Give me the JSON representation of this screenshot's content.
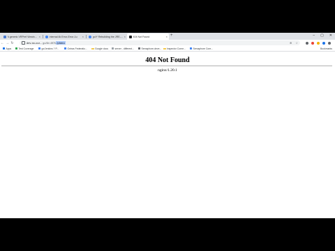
{
  "tabs": [
    {
      "title": "A generic VRPerf Viewing S",
      "active": false,
      "favicon_color": "#4a7bd0"
    },
    {
      "title": "Internal 4k Error-Error-1u",
      "active": false,
      "favicon_color": "#4285f4"
    },
    {
      "title": "go/Y Rebuilding the JRE-Sc",
      "active": false,
      "favicon_color": "#4285f4"
    },
    {
      "title": "404 Not Found",
      "active": true,
      "favicon_color": "#202124"
    }
  ],
  "new_tab_symbol": "+",
  "window_controls": {
    "minimize": "–",
    "maximize": "▢",
    "close": "✕"
  },
  "toolbar": {
    "back": "←",
    "forward": "→",
    "reload": "↻"
  },
  "address_bar": {
    "url_host": "dev-nc-cur...",
    "url_path": "go/6r=8f7b",
    "url_selected": "/phero",
    "extension_colors": [
      "#5f6368",
      "#ea4335",
      "#f4b400",
      "#1a73e8",
      "#5f6368"
    ],
    "actions": {
      "zoom": "⊕",
      "star": "☆"
    }
  },
  "bookmarks": [
    {
      "label": "Apps",
      "kind": "icon",
      "color": "#1a73e8"
    },
    {
      "label": "Test Coverage",
      "kind": "icon",
      "color": "#34a853"
    },
    {
      "label": "go/Jenkins ? P...",
      "kind": "icon",
      "color": "#4285f4"
    },
    {
      "label": "Ontras Federatio...",
      "kind": "icon",
      "color": "#4285f4"
    },
    {
      "label": "Google docs",
      "kind": "folder",
      "color": "#f2c94c"
    },
    {
      "label": "server - different...",
      "kind": "icon",
      "color": "#9aa0a6"
    },
    {
      "label": "Semaphore-deve...",
      "kind": "icon",
      "color": "#5f6368"
    },
    {
      "label": "Inspector Corne...",
      "kind": "folder",
      "color": "#f2c94c"
    },
    {
      "label": "Semaphore Core...",
      "kind": "icon",
      "color": "#4285f4"
    }
  ],
  "other_bookmarks": "Bookmarks",
  "page": {
    "heading": "404 Not Found",
    "server": "nginx/1.20.1"
  }
}
